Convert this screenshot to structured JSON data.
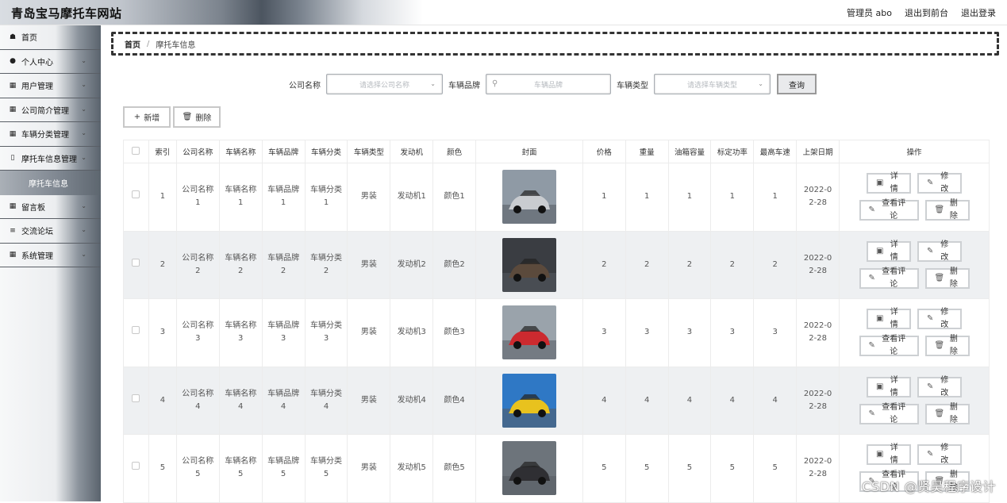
{
  "header": {
    "site_title": "青岛宝马摩托车网站",
    "user_label": "管理员 abo",
    "back_front_label": "退出到前台",
    "logout_label": "退出登录"
  },
  "sidebar": {
    "items": [
      {
        "icon": "home-icon",
        "label": "首页",
        "has_chevron": false
      },
      {
        "icon": "user-icon",
        "label": "个人中心",
        "has_chevron": true
      },
      {
        "icon": "grid-icon",
        "label": "用户管理",
        "has_chevron": true
      },
      {
        "icon": "grid-icon",
        "label": "公司简介管理",
        "has_chevron": true
      },
      {
        "icon": "grid-icon",
        "label": "车辆分类管理",
        "has_chevron": true
      },
      {
        "icon": "doc-icon",
        "label": "摩托车信息管理",
        "has_chevron": true
      },
      {
        "icon": "",
        "label": "摩托车信息",
        "has_chevron": false,
        "active": true
      },
      {
        "icon": "grid-icon",
        "label": "留言板",
        "has_chevron": true
      },
      {
        "icon": "sliders-icon",
        "label": "交流论坛",
        "has_chevron": true
      },
      {
        "icon": "grid-icon",
        "label": "系统管理",
        "has_chevron": true
      }
    ]
  },
  "breadcrumb": {
    "home": "首页",
    "separator": "/",
    "current": "摩托车信息"
  },
  "search": {
    "company_label": "公司名称",
    "company_placeholder": "请选择公司名称",
    "brand_label": "车辆品牌",
    "brand_placeholder": "车辆品牌",
    "type_label": "车辆类型",
    "type_placeholder": "请选择车辆类型",
    "query_label": "查询"
  },
  "actions": {
    "add_label": "新增",
    "delete_label": "删除"
  },
  "table": {
    "headers": [
      "",
      "索引",
      "公司名称",
      "车辆名称",
      "车辆品牌",
      "车辆分类",
      "车辆类型",
      "发动机",
      "颜色",
      "封面",
      "价格",
      "重量",
      "油箱容量",
      "标定功率",
      "最高车速",
      "上架日期",
      "操作"
    ],
    "rows": [
      {
        "index": "1",
        "company": "公司名称1",
        "name": "车辆名称1",
        "brand": "车辆品牌1",
        "category": "车辆分类1",
        "type": "男装",
        "engine": "发动机1",
        "color": "颜色1",
        "price": "1",
        "weight": "1",
        "tank": "1",
        "power": "1",
        "speed": "1",
        "date": "2022-02-28"
      },
      {
        "index": "2",
        "company": "公司名称2",
        "name": "车辆名称2",
        "brand": "车辆品牌2",
        "category": "车辆分类2",
        "type": "男装",
        "engine": "发动机2",
        "color": "颜色2",
        "price": "2",
        "weight": "2",
        "tank": "2",
        "power": "2",
        "speed": "2",
        "date": "2022-02-28"
      },
      {
        "index": "3",
        "company": "公司名称3",
        "name": "车辆名称3",
        "brand": "车辆品牌3",
        "category": "车辆分类3",
        "type": "男装",
        "engine": "发动机3",
        "color": "颜色3",
        "price": "3",
        "weight": "3",
        "tank": "3",
        "power": "3",
        "speed": "3",
        "date": "2022-02-28"
      },
      {
        "index": "4",
        "company": "公司名称4",
        "name": "车辆名称4",
        "brand": "车辆品牌4",
        "category": "车辆分类4",
        "type": "男装",
        "engine": "发动机4",
        "color": "颜色4",
        "price": "4",
        "weight": "4",
        "tank": "4",
        "power": "4",
        "speed": "4",
        "date": "2022-02-28"
      },
      {
        "index": "5",
        "company": "公司名称5",
        "name": "车辆名称5",
        "brand": "车辆品牌5",
        "category": "车辆分类5",
        "type": "男装",
        "engine": "发动机5",
        "color": "颜色5",
        "price": "5",
        "weight": "5",
        "tank": "5",
        "power": "5",
        "speed": "5",
        "date": "2022-02-28"
      }
    ],
    "op_labels": {
      "detail": "详情",
      "edit": "修改",
      "comments": "查看评论",
      "delete": "删除"
    },
    "cover_colors": [
      {
        "bg": "#8f9aa5",
        "car": "#c9ccd0"
      },
      {
        "bg": "#3a3d42",
        "car": "#5b4a3c"
      },
      {
        "bg": "#9aa3ab",
        "car": "#cc2a2f"
      },
      {
        "bg": "#2f78c5",
        "car": "#e8c21e"
      },
      {
        "bg": "#6d747b",
        "car": "#2f2f33"
      }
    ]
  },
  "watermark": "CSDN @贤昊程序设计"
}
